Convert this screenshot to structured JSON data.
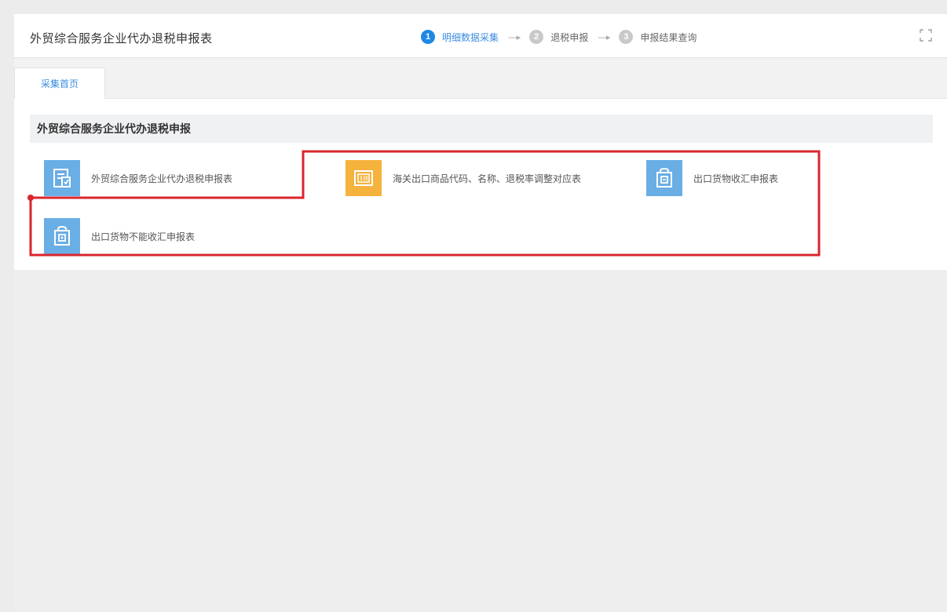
{
  "header": {
    "title": "外贸综合服务企业代办退税申报表",
    "steps": [
      {
        "num": "1",
        "label": "明细数据采集",
        "active": true
      },
      {
        "num": "2",
        "label": "退税申报",
        "active": false
      },
      {
        "num": "3",
        "label": "申报结果查询",
        "active": false
      }
    ],
    "arrow": "----▸",
    "fullscreen_icon": "⛶"
  },
  "tabs": [
    {
      "label": "采集首页"
    }
  ],
  "section": {
    "title": "外贸综合服务企业代办退税申报"
  },
  "items": [
    {
      "label": "外贸综合服务企业代办退税申报表",
      "icon": "document-icon",
      "color": "#6aaee6"
    },
    {
      "label": "海关出口商品代码、名称、退税率调整对应表",
      "icon": "table-icon",
      "color": "#f5b23d"
    },
    {
      "label": "出口货物收汇申报表",
      "icon": "bag-icon",
      "color": "#6aaee6"
    },
    {
      "label": "出口货物不能收汇申报表",
      "icon": "bag-icon",
      "color": "#6aaee6"
    }
  ],
  "colors": {
    "accent": "#1e88e5",
    "annotation": "#d9262c"
  }
}
